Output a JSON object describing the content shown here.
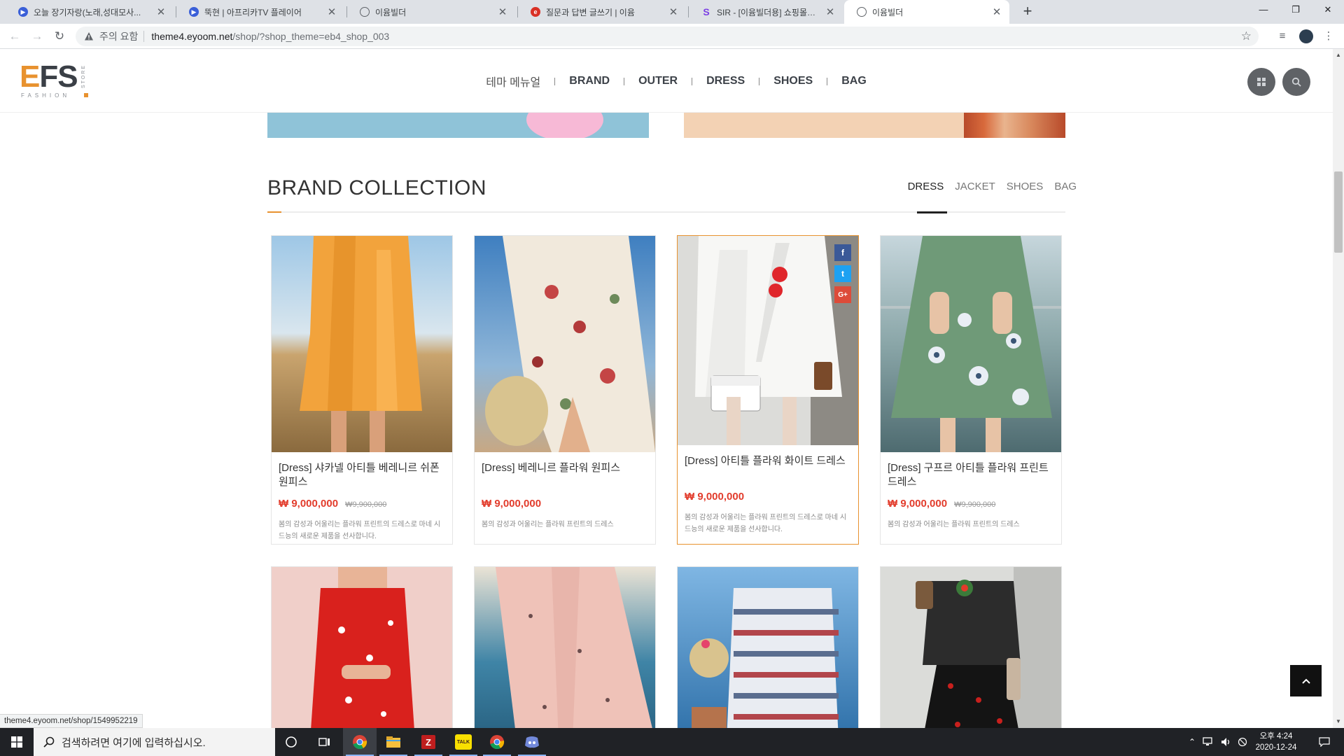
{
  "browser": {
    "tabs": [
      {
        "title": "오늘 장기자랑(노래,성대모사...",
        "favicon_color": "#3a5fd8"
      },
      {
        "title": "뚝현 | 아프리카TV 플레이어",
        "favicon_color": "#3a5fd8"
      },
      {
        "title": "이윰빌더",
        "favicon_color": "#5f6368"
      },
      {
        "title": "질문과 답변 글쓰기 | 이윰",
        "favicon_color": "#d93025"
      },
      {
        "title": "SIR - [이윰빌더용] 쇼핑몰테마 =",
        "favicon_color": "#7b3fe4"
      },
      {
        "title": "이윰빌더",
        "favicon_color": "#5f6368"
      }
    ],
    "tab_close_glyph": "✕",
    "new_tab_glyph": "+",
    "window_controls": [
      "—",
      "❐",
      "✕"
    ],
    "security_label": "주의 요함",
    "url_host": "theme4.eyoom.net",
    "url_path": "/shop/?shop_theme=eb4_shop_003",
    "status_url": "theme4.eyoom.net/shop/1549952219"
  },
  "site": {
    "logo": {
      "e": "E",
      "fs": "FS",
      "sub": "FASHION",
      "vertical": "STORE"
    },
    "nav": [
      "테마 메뉴얼",
      "BRAND",
      "OUTER",
      "DRESS",
      "SHOES",
      "BAG"
    ],
    "accent": "#e8922f"
  },
  "section": {
    "title": "BRAND COLLECTION",
    "tabs": [
      "DRESS",
      "JACKET",
      "SHOES",
      "BAG"
    ],
    "active_tab": "DRESS"
  },
  "products": [
    {
      "name": "[Dress] 샤카넬 아티틀 베레니르 쉬폰 원피스",
      "price": "₩ 9,000,000",
      "old_price": "₩9,900,000",
      "desc": "봄의 감성과 어울리는 플라워 프린트의 드레스로 마네 시드능의 새로운 제품을 선사합니다."
    },
    {
      "name": "[Dress] 베레니르 플라워 원피스",
      "price": "₩ 9,000,000",
      "old_price": "",
      "desc": "봄의 감성과 어울리는 플라워 프린트의 드레스"
    },
    {
      "name": "[Dress] 아티틀 플라워 화이트 드레스",
      "price": "₩ 9,000,000",
      "old_price": "",
      "desc": "봄의 감성과 어울리는 플라워 프린트의 드레스로 마네 시드능의 새로운 제품을 선사합니다."
    },
    {
      "name": "[Dress] 구프르 아티틀 플라워 프린트 드레스",
      "price": "₩ 9,000,000",
      "old_price": "₩9,900,000",
      "desc": "봄의 감성과 어울리는 플라워 프린트의 드레스"
    }
  ],
  "share": {
    "facebook": "f",
    "twitter": "t",
    "google": "G+"
  },
  "taskbar": {
    "search_placeholder": "검색하려면 여기에 입력하십시오.",
    "kakao_label": "TALK",
    "clock_time": "오후 4:24",
    "clock_date": "2020-12-24"
  }
}
